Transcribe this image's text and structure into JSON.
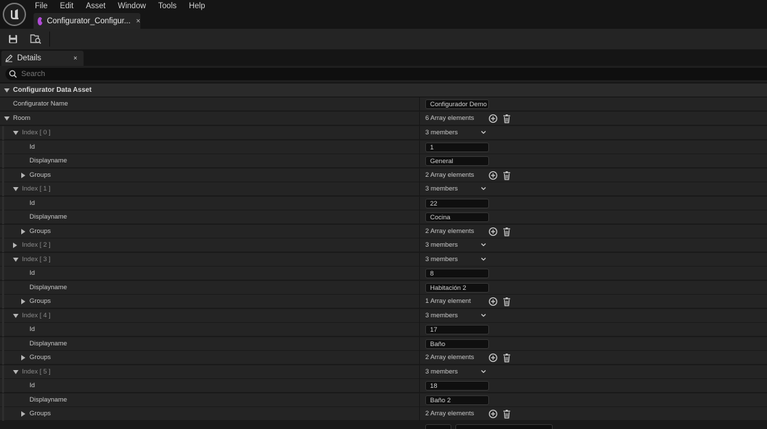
{
  "menu": [
    "File",
    "Edit",
    "Asset",
    "Window",
    "Tools",
    "Help"
  ],
  "doc_tab": {
    "label": "Configurator_Configur...",
    "close": "×"
  },
  "toolbar": {
    "save_icon": "save-icon",
    "browse_icon": "browse-asset-icon"
  },
  "details": {
    "tab_label": "Details",
    "tab_close": "×",
    "search_placeholder": "Search",
    "category": "Configurator Data Asset",
    "configurator_name_label": "Configurator Name",
    "configurator_name_value": "Configurador Demo",
    "room_label": "Room",
    "room_count": "6 Array elements",
    "rooms": [
      {
        "index": "Index [ 0 ]",
        "members": "3 members",
        "expanded": true,
        "id_label": "Id",
        "id": "1",
        "display_label": "Displayname",
        "displayname": "General",
        "groups_label": "Groups",
        "groups": "2 Array elements"
      },
      {
        "index": "Index [ 1 ]",
        "members": "3 members",
        "expanded": true,
        "id_label": "Id",
        "id": "22",
        "display_label": "Displayname",
        "displayname": "Cocina",
        "groups_label": "Groups",
        "groups": "2 Array elements"
      },
      {
        "index": "Index [ 2 ]",
        "members": "3 members",
        "expanded": false
      },
      {
        "index": "Index [ 3 ]",
        "members": "3 members",
        "expanded": true,
        "id_label": "Id",
        "id": "8",
        "display_label": "Displayname",
        "displayname": "Habitación 2",
        "groups_label": "Groups",
        "groups": "1 Array element"
      },
      {
        "index": "Index [ 4 ]",
        "members": "3 members",
        "expanded": true,
        "id_label": "Id",
        "id": "17",
        "display_label": "Displayname",
        "displayname": "Baño",
        "groups_label": "Groups",
        "groups": "2 Array elements"
      },
      {
        "index": "Index [ 5 ]",
        "members": "3 members",
        "expanded": true,
        "id_label": "Id",
        "id": "18",
        "display_label": "Displayname",
        "displayname": "Baño 2",
        "groups_label": "Groups",
        "groups": "2 Array elements"
      }
    ]
  },
  "colors": {
    "background": "#151515",
    "row": "#242424",
    "asset_accent": "#b24bd9"
  }
}
